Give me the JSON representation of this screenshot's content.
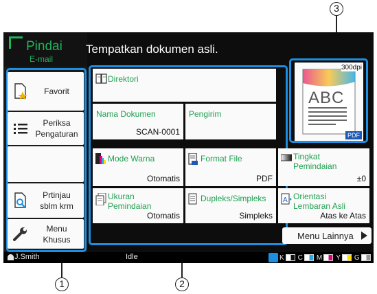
{
  "callouts": {
    "one": "1",
    "two": "2",
    "three": "3"
  },
  "app": {
    "title": "Pindai",
    "subtitle": "E-mail"
  },
  "message": "Tempatkan dokumen asli.",
  "sidebar": {
    "favorit": "Favorit",
    "periksa_line1": "Periksa",
    "periksa_line2": "Pengaturan",
    "prtinjau_line1": "Prtinjau",
    "prtinjau_line2": "sblm krm",
    "menu_line1": "Menu",
    "menu_line2": "Khusus"
  },
  "settings": {
    "direktori": "Direktori",
    "nama_dokumen": {
      "label": "Nama Dokumen",
      "value": "SCAN-0001"
    },
    "pengirim": {
      "label": "Pengirim",
      "value": ""
    },
    "mode_warna": {
      "label": "Mode Warna",
      "value": "Otomatis"
    },
    "format_file": {
      "label": "Format File",
      "value": "PDF"
    },
    "tingkat": {
      "label_line1": "Tingkat",
      "label_line2": "Pemindaian",
      "value": "±0"
    },
    "ukuran": {
      "label_line1": "Ukuran",
      "label_line2": "Pemindaian",
      "value": "Otomatis"
    },
    "dupleks": {
      "label": "Dupleks/Simpleks",
      "value": "Simpleks"
    },
    "orientasi": {
      "label_line1": "Orientasi",
      "label_line2": "Lembaran Asli",
      "value": "Atas ke Atas"
    }
  },
  "preview": {
    "resolution": "300dpi",
    "doc_text": "ABC",
    "format_badge": "PDF"
  },
  "more_button": "Menu Lainnya",
  "status": {
    "user": "J.Smith",
    "state": "Idle",
    "inks": [
      "K",
      "C",
      "M",
      "Y",
      "G"
    ],
    "ink_colors": {
      "K": "#111111",
      "C": "#29a9e1",
      "M": "#e6007e",
      "Y": "#ffe000",
      "G": "#9a9a9a"
    }
  }
}
